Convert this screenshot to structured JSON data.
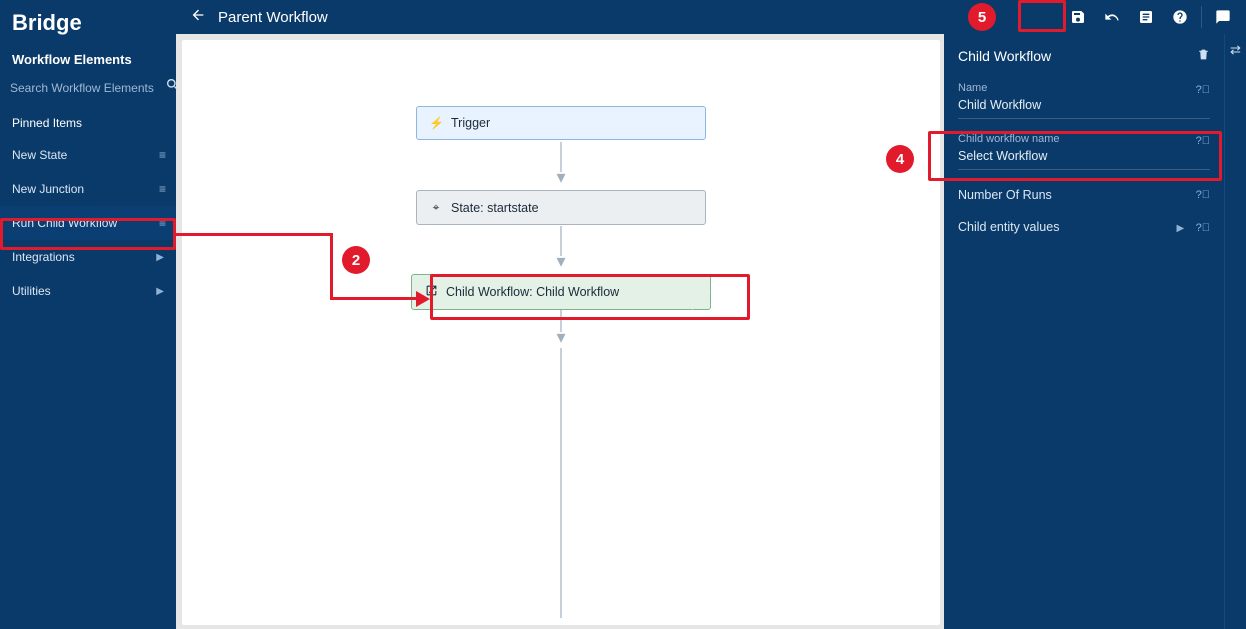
{
  "app": {
    "brand": "Bridge"
  },
  "sidebar": {
    "header": "Workflow Elements",
    "searchPlaceholder": "Search Workflow Elements",
    "pinnedHeader": "Pinned Items",
    "items": [
      {
        "label": "New State"
      },
      {
        "label": "New Junction"
      },
      {
        "label": "Run Child Workflow"
      },
      {
        "label": "Integrations"
      },
      {
        "label": "Utilities"
      }
    ]
  },
  "topbar": {
    "title": "Parent Workflow"
  },
  "canvas": {
    "nodes": {
      "trigger": "Trigger",
      "state": "State: startstate",
      "child": "Child Workflow: Child Workflow"
    }
  },
  "props": {
    "title": "Child Workflow",
    "name": {
      "label": "Name",
      "value": "Child Workflow"
    },
    "childName": {
      "label": "Child workflow name",
      "value": "Select Workflow"
    },
    "runs": {
      "label": "Number Of Runs"
    },
    "entity": {
      "label": "Child entity values"
    }
  },
  "callouts": {
    "b2": "2",
    "b4": "4",
    "b5": "5"
  }
}
